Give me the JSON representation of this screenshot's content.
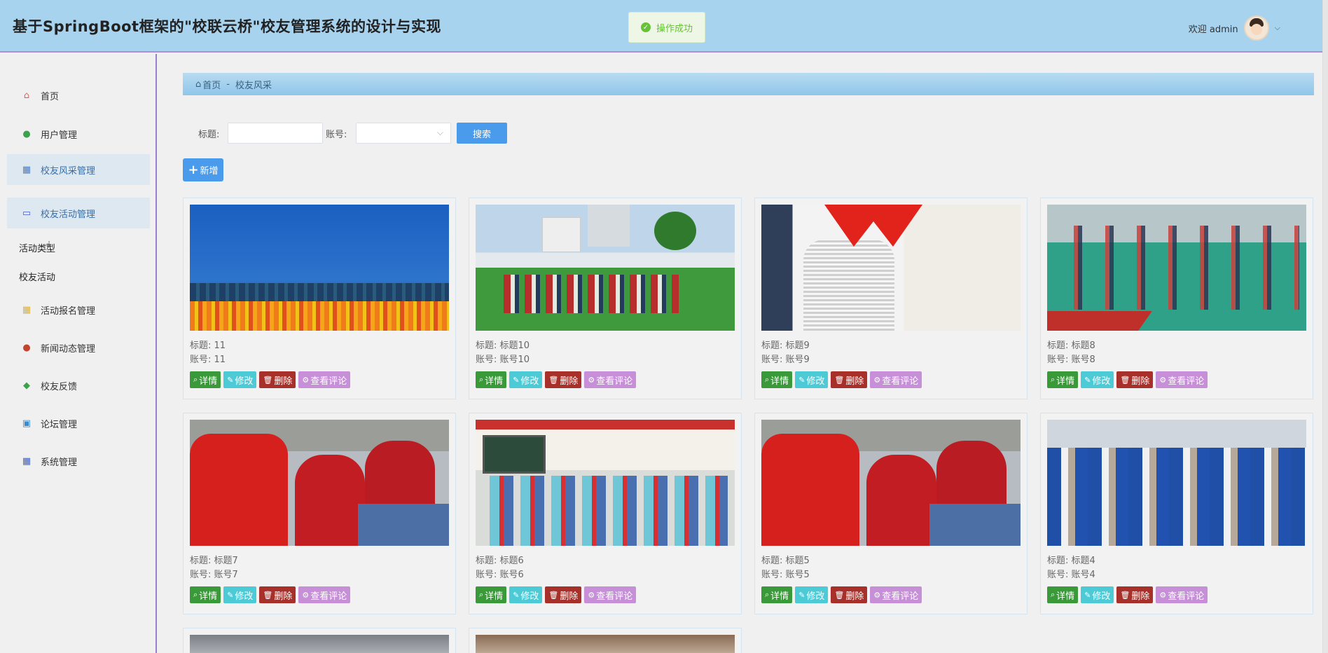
{
  "header": {
    "title": "基于SpringBoot框架的\"校联云桥\"校友管理系统的设计与实现",
    "toast": "操作成功",
    "welcome": "欢迎 admin"
  },
  "sidebar": {
    "items": [
      {
        "label": "首页",
        "icon": "home-icon",
        "color": "#e06060"
      },
      {
        "label": "用户管理",
        "icon": "user-icon",
        "color": "#3aa24a"
      },
      {
        "label": "校友风采管理",
        "icon": "grid-icon",
        "color": "#4a7bd0"
      },
      {
        "label": "校友活动管理",
        "icon": "card-icon",
        "color": "#4a5fd0"
      },
      {
        "label": "活动报名管理",
        "icon": "grid-icon",
        "color": "#e0b030"
      },
      {
        "label": "新闻动态管理",
        "icon": "circle-icon",
        "color": "#c0442e"
      },
      {
        "label": "校友反馈",
        "icon": "feedback-icon",
        "color": "#3aa24a"
      },
      {
        "label": "论坛管理",
        "icon": "window-icon",
        "color": "#3a8ad0"
      },
      {
        "label": "系统管理",
        "icon": "grid-icon",
        "color": "#3a5fd0"
      }
    ],
    "sub_items": [
      "活动类型",
      "校友活动"
    ]
  },
  "breadcrumb": {
    "home": "首页",
    "separator": "-",
    "current": "校友风采"
  },
  "search": {
    "title_label": "标题:",
    "title_value": "",
    "account_label": "账号:",
    "account_value": "",
    "button": "搜索"
  },
  "add_button": "新增",
  "card_labels": {
    "title_prefix": "标题:",
    "account_prefix": "账号:",
    "detail": "详情",
    "edit": "修改",
    "delete": "删除",
    "comment": "查看评论"
  },
  "cards": [
    {
      "title": "11",
      "account": "11",
      "image": "flower-field-photo"
    },
    {
      "title": "标题10",
      "account": "账号10",
      "image": "school-field-dance-photo"
    },
    {
      "title": "标题9",
      "account": "账号9",
      "image": "kids-red-scarf-photo"
    },
    {
      "title": "标题8",
      "account": "账号8",
      "image": "basketball-court-photo"
    },
    {
      "title": "标题7",
      "account": "账号7",
      "image": "classroom-volunteer-photo"
    },
    {
      "title": "标题6",
      "account": "账号6",
      "image": "classroom-photo"
    },
    {
      "title": "标题5",
      "account": "账号5",
      "image": "classroom-volunteer-photo"
    },
    {
      "title": "标题4",
      "account": "账号4",
      "image": "students-crowd-photo"
    }
  ],
  "colors": {
    "header_bg": "#a7d3ef",
    "primary": "#4a9bec",
    "detail": "#3a9a3a",
    "edit": "#4ccad6",
    "delete": "#a8302a",
    "comment": "#c78fd8"
  }
}
